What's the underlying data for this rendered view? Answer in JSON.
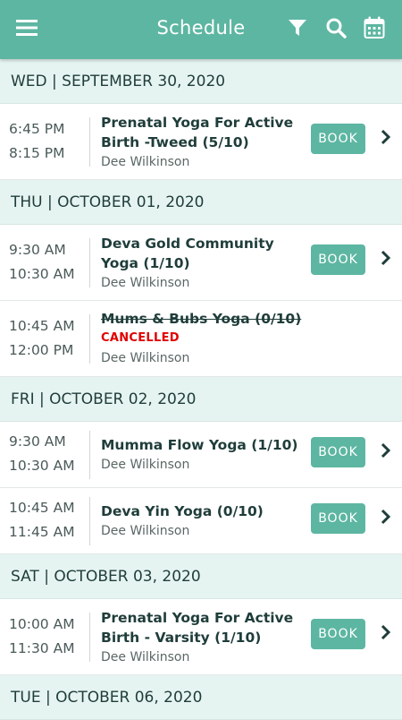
{
  "header": {
    "title": "Schedule",
    "icons": [
      "menu-icon",
      "filter-icon",
      "search-icon",
      "calendar-icon"
    ]
  },
  "colors": {
    "accent": "#5db6a2",
    "day_header_bg": "#e6f4f1",
    "cancelled": "#e00000"
  },
  "days": [
    {
      "label": "WED | SEPTEMBER 30, 2020",
      "classes": [
        {
          "start": "6:45 PM",
          "end": "8:15 PM",
          "name": "Prenatal Yoga For Active Birth -Tweed (5/10)",
          "teacher": "Dee Wilkinson",
          "action": "BOOK",
          "cancelled": false
        }
      ]
    },
    {
      "label": "THU | OCTOBER 01, 2020",
      "classes": [
        {
          "start": "9:30 AM",
          "end": "10:30 AM",
          "name": "Deva Gold Community Yoga (1/10)",
          "teacher": "Dee Wilkinson",
          "action": "BOOK",
          "cancelled": false
        },
        {
          "start": "10:45 AM",
          "end": "12:00 PM",
          "name": "Mums & Bubs Yoga (0/10)",
          "status": "CANCELLED",
          "teacher": "Dee Wilkinson",
          "cancelled": true
        }
      ]
    },
    {
      "label": "FRI | OCTOBER 02, 2020",
      "classes": [
        {
          "start": "9:30 AM",
          "end": "10:30 AM",
          "name": "Mumma Flow Yoga (1/10)",
          "teacher": "Dee Wilkinson",
          "action": "BOOK",
          "cancelled": false
        },
        {
          "start": "10:45 AM",
          "end": "11:45 AM",
          "name": "Deva Yin Yoga (0/10)",
          "teacher": "Dee Wilkinson",
          "action": "BOOK",
          "cancelled": false
        }
      ]
    },
    {
      "label": "SAT | OCTOBER 03, 2020",
      "classes": [
        {
          "start": "10:00 AM",
          "end": "11:30 AM",
          "name": "Prenatal Yoga For Active Birth - Varsity (1/10)",
          "teacher": "Dee Wilkinson",
          "action": "BOOK",
          "cancelled": false
        }
      ]
    },
    {
      "label": "TUE | OCTOBER 06, 2020",
      "classes": []
    }
  ]
}
